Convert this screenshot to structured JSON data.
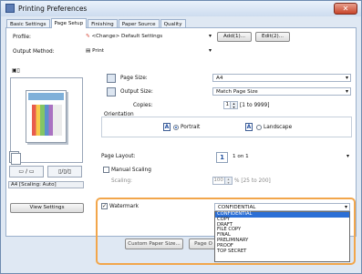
{
  "window": {
    "title": "Printing Preferences",
    "close_glyph": "✕",
    "title_icon": "printer-icon"
  },
  "tabs": [
    {
      "label": "Basic Settings"
    },
    {
      "label": "Page Setup",
      "active": true
    },
    {
      "label": "Finishing"
    },
    {
      "label": "Paper Source"
    },
    {
      "label": "Quality"
    }
  ],
  "profile": {
    "label": "Profile:",
    "value": "<Change> Default Settings",
    "add_label": "Add(1)...",
    "edit_label": "Edit(2)..."
  },
  "output_method": {
    "label": "Output Method:",
    "value": "Print"
  },
  "page_size": {
    "label": "Page Size:",
    "value": "A4"
  },
  "output_size": {
    "label": "Output Size:",
    "value": "Match Page Size"
  },
  "copies": {
    "label": "Copies:",
    "value": "1",
    "range": "[1 to 9999]"
  },
  "orientation": {
    "label": "Orientation",
    "portrait_label": "Portrait",
    "landscape_label": "Landscape",
    "glyph": "A",
    "selected": "Portrait"
  },
  "page_layout": {
    "label": "Page Layout:",
    "number": "1",
    "value": "1 on 1"
  },
  "manual_scaling": {
    "label": "Manual Scaling",
    "checked": false
  },
  "scaling": {
    "label": "Scaling:",
    "value": "100",
    "range": "% [25 to 200]"
  },
  "preview": {
    "status": "A4 [Scaling: Auto]"
  },
  "view_settings_label": "View Settings",
  "watermark": {
    "label": "Watermark",
    "checked": true,
    "selected": "CONFIDENTIAL",
    "options": [
      "CONFIDENTIAL",
      "COPY",
      "DRAFT",
      "FILE COPY",
      "FINAL",
      "PRELIMINARY",
      "PROOF",
      "TOP SECRET"
    ]
  },
  "custom_paper_size_label": "Custom Paper Size...",
  "page_options_label": "Page O",
  "colors": {
    "accent": "#f2a64b",
    "selection": "#2b6fd6",
    "frame": "#dfe8f3"
  }
}
